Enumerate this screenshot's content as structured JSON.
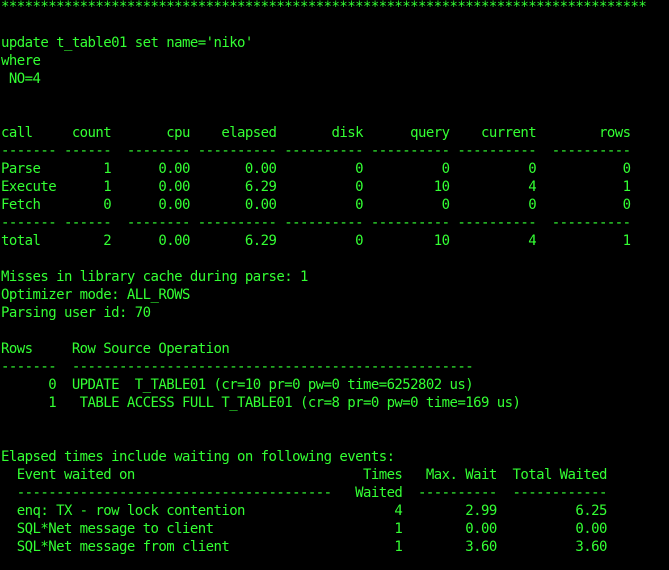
{
  "colors": {
    "background": "#000000",
    "text": "#33ff33"
  },
  "terminal": {
    "lines": [
      "**********************************************************************************",
      "",
      "update t_table01 set name='niko'",
      "where",
      " NO=4",
      "",
      "",
      "call     count       cpu    elapsed       disk      query    current        rows",
      "------- ------  -------- ---------- ---------- ---------- ----------  ----------",
      "Parse        1      0.00       0.00          0          0          0           0",
      "Execute      1      0.00       6.29          0         10          4           1",
      "Fetch        0      0.00       0.00          0          0          0           0",
      "------- ------  -------- ---------- ---------- ---------- ----------  ----------",
      "total        2      0.00       6.29          0         10          4           1",
      "",
      "Misses in library cache during parse: 1",
      "Optimizer mode: ALL_ROWS",
      "Parsing user id: 70",
      "",
      "Rows     Row Source Operation",
      "-------  ---------------------------------------------------",
      "      0  UPDATE  T_TABLE01 (cr=10 pr=0 pw=0 time=6252802 us)",
      "      1   TABLE ACCESS FULL T_TABLE01 (cr=8 pr=0 pw=0 time=169 us)",
      "",
      "",
      "Elapsed times include waiting on following events:",
      "  Event waited on                             Times   Max. Wait  Total Waited",
      "  ----------------------------------------   Waited  ----------  ------------",
      "  enq: TX - row lock contention                   4        2.99          6.25",
      "  SQL*Net message to client                       1        0.00          0.00",
      "  SQL*Net message from client                     1        3.60          3.60"
    ]
  }
}
